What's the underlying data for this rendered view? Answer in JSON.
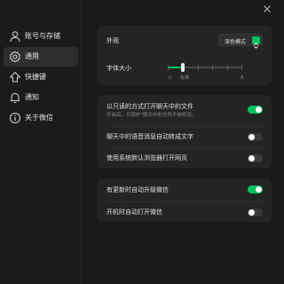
{
  "sidebar": {
    "items": [
      {
        "label": "账号与存储",
        "icon": "user-icon"
      },
      {
        "label": "通用",
        "icon": "gear-icon"
      },
      {
        "label": "快捷键",
        "icon": "shortcut-icon"
      },
      {
        "label": "通知",
        "icon": "bell-icon"
      },
      {
        "label": "关于微信",
        "icon": "info-icon"
      }
    ],
    "active_index": 1
  },
  "appearance": {
    "label": "外观",
    "value": "深色模式"
  },
  "font_size": {
    "label": "字体大小",
    "min_label": "小",
    "standard_label": "标准",
    "max_label": "大",
    "level_fraction": 0.2
  },
  "file_settings": {
    "readonly_label": "以只读的方式打开聊天中的文件",
    "readonly_desc": "开启后，可保护\"聊天中的文件不被修改。",
    "readonly_on": true,
    "voice_to_text_label": "聊天中的语音消息自动转成文字",
    "voice_to_text_on": false,
    "browser_label": "使用系统默认浏览器打开网页",
    "browser_on": false
  },
  "update_settings": {
    "auto_update_label": "有更新时自动升级微信",
    "auto_update_on": true,
    "autostart_label": "开机时自动打开微信",
    "autostart_on": false
  },
  "colors": {
    "accent": "#07c160",
    "background": "#191919",
    "card": "#242424"
  }
}
